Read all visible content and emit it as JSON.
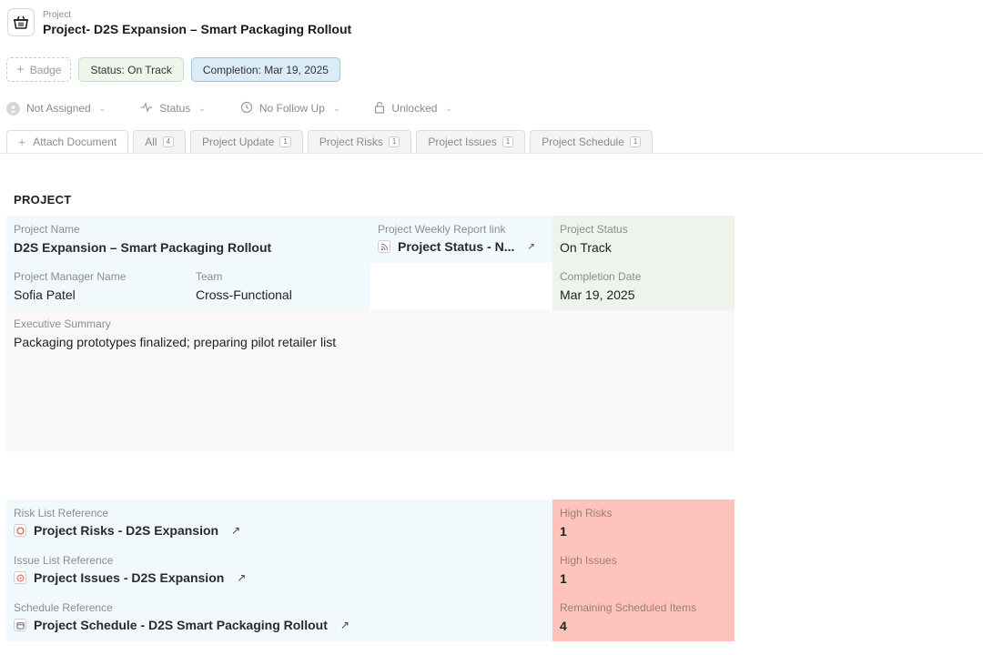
{
  "header": {
    "breadcrumb": "Project",
    "title": "Project- D2S Expansion – Smart Packaging Rollout",
    "icon": "basket-icon"
  },
  "badges": {
    "add_label": "Badge",
    "status": "Status: On Track",
    "completion": "Completion: Mar 19, 2025"
  },
  "properties": {
    "assignee": "Not Assigned",
    "status": "Status",
    "follow_up": "No Follow Up",
    "lock": "Unlocked"
  },
  "tabs": {
    "attach": "Attach Document",
    "items": [
      {
        "label": "All",
        "count": "4"
      },
      {
        "label": "Project Update",
        "count": "1"
      },
      {
        "label": "Project Risks",
        "count": "1"
      },
      {
        "label": "Project Issues",
        "count": "1"
      },
      {
        "label": "Project Schedule",
        "count": "1"
      }
    ]
  },
  "project": {
    "heading": "PROJECT",
    "name_label": "Project Name",
    "name_value": "D2S Expansion – Smart Packaging Rollout",
    "weekly_label": "Project Weekly Report link",
    "weekly_value": "Project Status - N...",
    "status_label": "Project Status",
    "status_value": "On Track",
    "manager_label": "Project Manager Name",
    "manager_value": "Sofia Patel",
    "team_label": "Team",
    "team_value": "Cross-Functional",
    "completion_label": "Completion Date",
    "completion_value": "Mar 19, 2025",
    "summary_label": "Executive Summary",
    "summary_value": "Packaging prototypes finalized; preparing pilot retailer list"
  },
  "references": {
    "risk_label": "Risk List Reference",
    "risk_value": "Project Risks - D2S Expansion",
    "issue_label": "Issue List Reference",
    "issue_value": "Project Issues - D2S Expansion",
    "schedule_label": "Schedule Reference",
    "schedule_value": "Project Schedule - D2S Smart Packaging Rollout",
    "high_risks_label": "High Risks",
    "high_risks_value": "1",
    "high_issues_label": "High Issues",
    "high_issues_value": "1",
    "remaining_label": "Remaining Scheduled Items",
    "remaining_value": "4"
  },
  "colors": {
    "blue_cell": "#f2f9fc",
    "green_cell": "#eef3ec",
    "gray_cell": "#f8f8f8",
    "red_cell": "#fec4bb",
    "status_badge": "#eef5ea",
    "completion_badge": "#d9ecf7"
  }
}
